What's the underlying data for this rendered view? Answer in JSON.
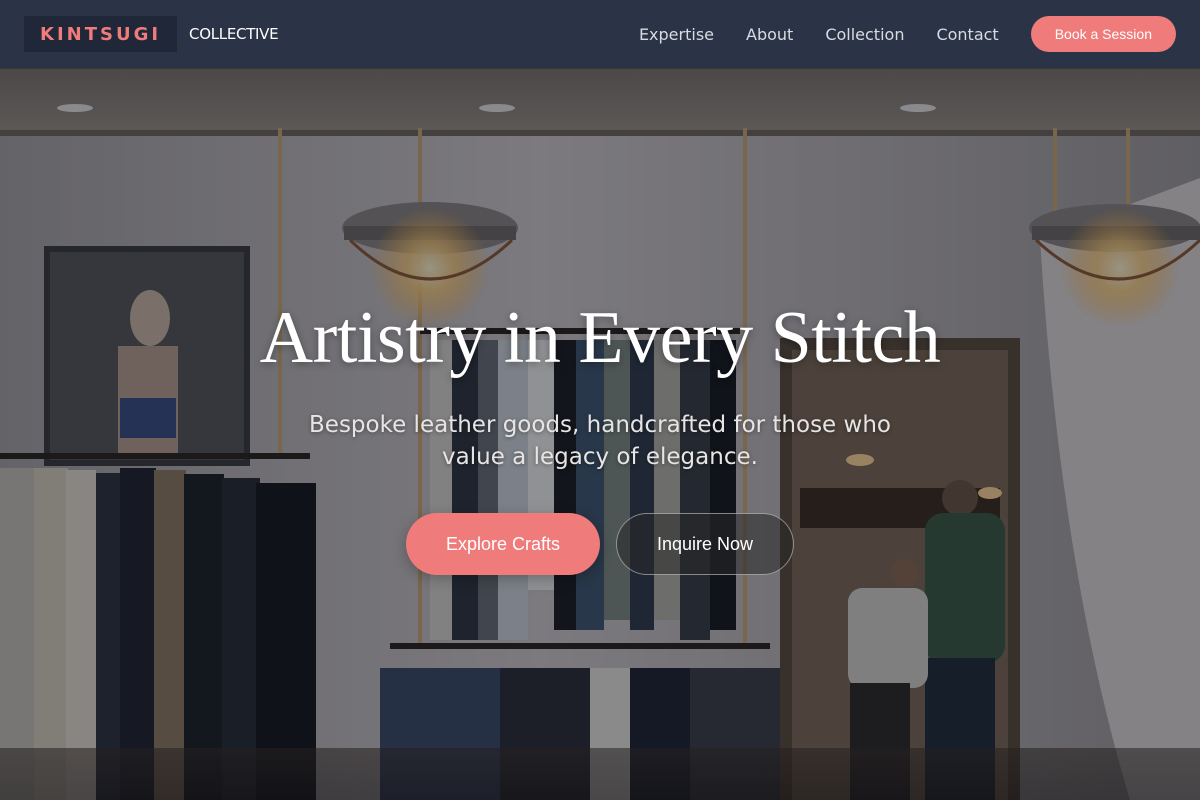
{
  "brand": {
    "name": "KINTSUGI",
    "subtitle": "COLLECTIVE",
    "accent_color": "#f07b7b",
    "nav_bg": "#2b3447"
  },
  "nav": {
    "links": [
      {
        "label": "Expertise"
      },
      {
        "label": "About"
      },
      {
        "label": "Collection"
      },
      {
        "label": "Contact"
      }
    ],
    "cta_label": "Book a Session"
  },
  "hero": {
    "title": "Artistry in Every Stitch",
    "subtitle": "Bespoke leather goods, handcrafted for those who value a legacy of elegance.",
    "primary_button": "Explore Crafts",
    "secondary_button": "Inquire Now",
    "background_image": "boutique-interior"
  }
}
